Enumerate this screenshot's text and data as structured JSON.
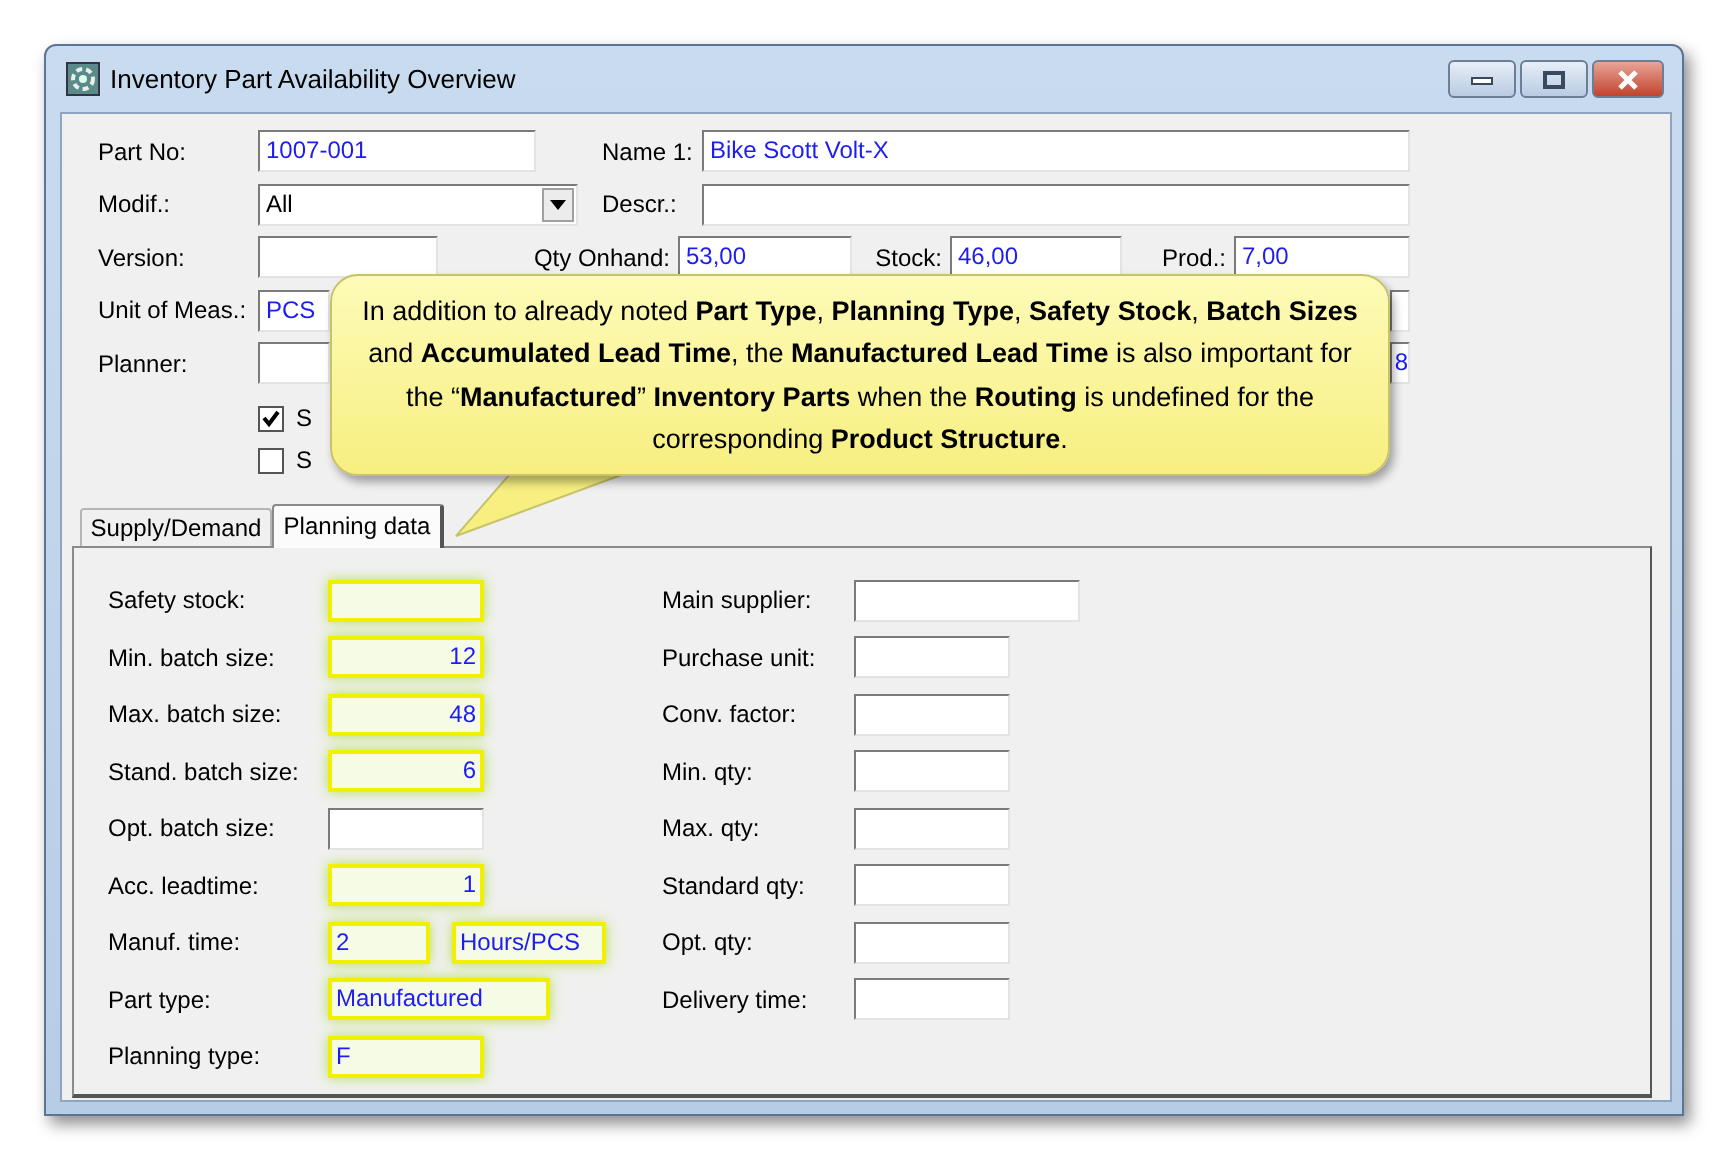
{
  "window": {
    "title": "Inventory Part Availability Overview"
  },
  "header": {
    "part_no": {
      "label": "Part No:",
      "value": "1007-001"
    },
    "name_1": {
      "label": "Name 1:",
      "value": "Bike Scott Volt-X"
    },
    "modif": {
      "label": "Modif.:",
      "value": "All"
    },
    "descr": {
      "label": "Descr.:"
    },
    "version": {
      "label": "Version:"
    },
    "qty_onhand": {
      "label": "Qty Onhand:",
      "value": "53,00"
    },
    "stock": {
      "label": "Stock:",
      "value": "46,00"
    },
    "prod": {
      "label": "Prod.:",
      "value": "7,00"
    },
    "unit_of_meas": {
      "label": "Unit of Meas.:",
      "value": "PCS"
    },
    "planner": {
      "label": "Planner:"
    },
    "planner_row_field": {
      "value": "8"
    },
    "checkboxes": [
      {
        "label": "S",
        "checked": true
      },
      {
        "label": "S",
        "checked": false
      }
    ]
  },
  "tabs": [
    {
      "label": "Supply/Demand",
      "selected": false
    },
    {
      "label": "Planning data",
      "selected": true
    }
  ],
  "planning_data": {
    "left": [
      {
        "label": "Safety stock:",
        "fields": [
          {
            "highlighted": true
          }
        ]
      },
      {
        "label": "Min. batch size:",
        "fields": [
          {
            "value": "12",
            "highlighted": true
          }
        ]
      },
      {
        "label": "Max. batch size:",
        "fields": [
          {
            "value": "48",
            "highlighted": true
          }
        ]
      },
      {
        "label": "Stand. batch size:",
        "fields": [
          {
            "value": "6",
            "highlighted": true
          }
        ]
      },
      {
        "label": "Opt. batch size:",
        "fields": [
          {
            "highlighted": false
          }
        ]
      },
      {
        "label": "Acc. leadtime:",
        "fields": [
          {
            "value": "1",
            "highlighted": true
          }
        ]
      },
      {
        "label": "Manuf. time:",
        "fields": [
          {
            "value": "2",
            "highlighted": true
          },
          {
            "value": "Hours/PCS",
            "highlighted": true
          }
        ]
      },
      {
        "label": "Part type:",
        "fields": [
          {
            "value": "Manufactured",
            "highlighted": true
          }
        ]
      },
      {
        "label": "Planning type:",
        "fields": [
          {
            "value": "F",
            "highlighted": true
          }
        ]
      }
    ],
    "right": [
      {
        "label": "Main supplier:"
      },
      {
        "label": "Purchase unit:"
      },
      {
        "label": "Conv. factor:"
      },
      {
        "label": "Min. qty:"
      },
      {
        "label": "Max. qty:"
      },
      {
        "label": "Standard qty:"
      },
      {
        "label": "Opt. qty:"
      },
      {
        "label": "Delivery time:"
      }
    ]
  },
  "callout": {
    "text": "In addition to already noted **Part Type**, **Planning Type**, **Safety Stock**, **Batch Sizes** and **Accumulated Lead Time**, the **Manufactured Lead Time** is also important for the “**Manufactured**” **Inventory Parts** when the **Routing** is undefined for the corresponding **Product Structure**."
  }
}
